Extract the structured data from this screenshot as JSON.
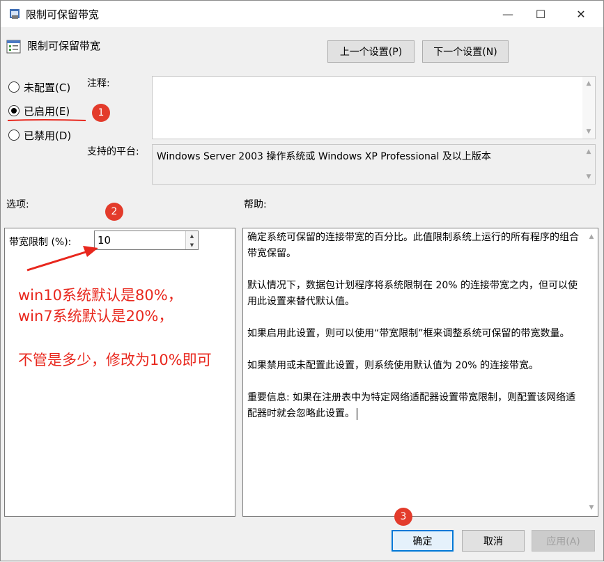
{
  "window": {
    "title": "限制可保留带宽"
  },
  "window_controls": {
    "minimize": "—",
    "maximize": "☐",
    "close": "✕"
  },
  "header": {
    "title": "限制可保留带宽"
  },
  "nav": {
    "prev": "上一个设置(P)",
    "next": "下一个设置(N)"
  },
  "state_options": [
    {
      "label": "未配置(C)",
      "checked": false
    },
    {
      "label": "已启用(E)",
      "checked": true
    },
    {
      "label": "已禁用(D)",
      "checked": false
    }
  ],
  "comment": {
    "label": "注释:",
    "value": ""
  },
  "platform": {
    "label": "支持的平台:",
    "value": "Windows Server 2003 操作系统或 Windows XP Professional 及以上版本"
  },
  "options": {
    "label": "选项:",
    "bandwidth_label": "带宽限制 (%):",
    "bandwidth_value": "10"
  },
  "help": {
    "label": "帮助:",
    "paragraphs": [
      "确定系统可保留的连接带宽的百分比。此值限制系统上运行的所有程序的组合带宽保留。",
      "默认情况下，数据包计划程序将系统限制在 20% 的连接带宽之内，但可以使用此设置来替代默认值。",
      "如果启用此设置，则可以使用“带宽限制”框来调整系统可保留的带宽数量。",
      "如果禁用或未配置此设置，则系统使用默认值为 20% 的连接带宽。",
      "重要信息: 如果在注册表中为特定网络适配器设置带宽限制，则配置该网络适配器时就会忽略此设置。"
    ]
  },
  "annotations": {
    "badge1": "1",
    "badge2": "2",
    "badge3": "3",
    "line1": "win10系统默认是80%，",
    "line2": "win7系统默认是20%，",
    "line3": "不管是多少，修改为10%即可"
  },
  "footer": {
    "ok": "确定",
    "cancel": "取消",
    "apply": "应用(A)"
  },
  "colors": {
    "annotation": "#e8271d",
    "accent": "#0078d7"
  }
}
